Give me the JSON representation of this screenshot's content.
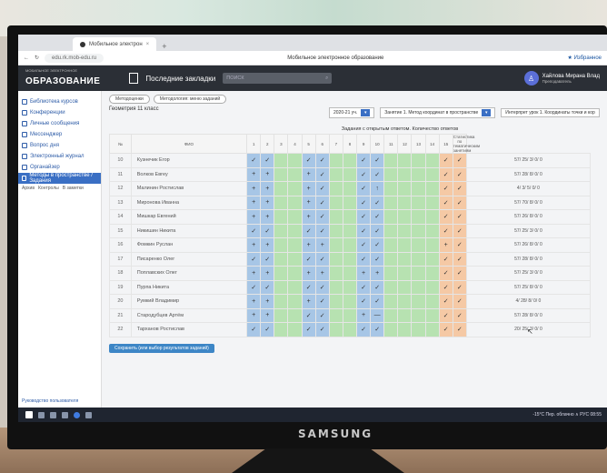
{
  "browser": {
    "tab_title": "Мобильное электрон",
    "url": "edu.rk.mob-edu.ru",
    "page_title": "Мобильное электронное образование",
    "right_link": "★ Избранное"
  },
  "app": {
    "logo_small": "МОБИЛЬНОЕ ЭЛЕКТРОННОЕ",
    "logo_big": "ОБРАЗОВАНИЕ",
    "bookmarks_label": "Последние закладки",
    "search_placeholder": "ПОИСК",
    "user_name": "Хайлова Мирана Влад",
    "user_role": "Преподаватель"
  },
  "sidebar": {
    "items": [
      {
        "label": "Библиотека курсов"
      },
      {
        "label": "Конференции"
      },
      {
        "label": "Личные сообщения"
      },
      {
        "label": "Мессенджер"
      },
      {
        "label": "Вопрос дня"
      },
      {
        "label": "Электронный журнал"
      },
      {
        "label": "Органайзер"
      },
      {
        "label": "Методы в пространстве / Задания"
      }
    ],
    "subnav": [
      "Архив",
      "Контролы",
      "В заметки"
    ],
    "footer": "Руководство пользователя"
  },
  "main": {
    "crumbs": [
      "Методоценки",
      "Методология: меню заданий"
    ],
    "subtitle": "Геометрия 11 класс",
    "selectors": [
      "2020-21 уч.",
      "Занятие 1. Метод координат в пространстве",
      "Интерпрет урок 1. Координаты точки и кор"
    ],
    "grid_title": "Задания с открытым ответом. Количество ответов",
    "col_headers": [
      "№",
      "ФИО",
      "1",
      "2",
      "3",
      "4",
      "5",
      "6",
      "7",
      "8",
      "9",
      "10",
      "11",
      "12",
      "13",
      "14",
      "15",
      "Статистика по тематическим занятиям"
    ],
    "save_label": "Сохранить (или выбор результатов заданий)"
  },
  "students": [
    {
      "num": "10",
      "name": "Кузнечик Егор",
      "stat": "57/ 25/ 3/ 0/ 0",
      "marks": [
        "✓",
        "✓",
        "",
        "",
        "✓",
        "✓",
        "",
        "",
        "✓",
        "✓",
        "",
        "",
        "",
        "",
        "✓",
        "✓"
      ]
    },
    {
      "num": "11",
      "name": "Волков Евгеу",
      "stat": "57/ 28/ 8/ 0/ 0",
      "marks": [
        "+",
        "+",
        "",
        "",
        "+",
        "✓",
        "",
        "",
        "✓",
        "✓",
        "",
        "",
        "",
        "",
        "✓",
        "✓"
      ]
    },
    {
      "num": "12",
      "name": "Малинин Ростислав",
      "stat": "4/ 3/ 5/ 0/ 0",
      "marks": [
        "+",
        "+",
        "",
        "",
        "+",
        "✓",
        "",
        "",
        "✓",
        "↑",
        "",
        "",
        "",
        "",
        "✓",
        "✓"
      ]
    },
    {
      "num": "13",
      "name": "Миронова Иванна",
      "stat": "57/ 70/ 8/ 0/ 0",
      "marks": [
        "+",
        "+",
        "",
        "",
        "+",
        "✓",
        "",
        "",
        "✓",
        "✓",
        "",
        "",
        "",
        "",
        "✓",
        "✓"
      ]
    },
    {
      "num": "14",
      "name": "Мишкар Евгений",
      "stat": "57/ 26/ 8/ 0/ 0",
      "marks": [
        "+",
        "+",
        "",
        "",
        "+",
        "✓",
        "",
        "",
        "✓",
        "✓",
        "",
        "",
        "",
        "",
        "✓",
        "✓"
      ]
    },
    {
      "num": "15",
      "name": "Никишин Никита",
      "stat": "57/ 25/ 3/ 0/ 0",
      "marks": [
        "✓",
        "✓",
        "",
        "",
        "✓",
        "✓",
        "",
        "",
        "✓",
        "✓",
        "",
        "",
        "",
        "",
        "✓",
        "✓"
      ]
    },
    {
      "num": "16",
      "name": "Фомкин Руслан",
      "stat": "57/ 26/ 8/ 0/ 0",
      "marks": [
        "+",
        "+",
        "",
        "",
        "+",
        "+",
        "",
        "",
        "✓",
        "✓",
        "",
        "",
        "",
        "",
        "+",
        "✓"
      ]
    },
    {
      "num": "17",
      "name": "Писаренко Олег",
      "stat": "57/ 28/ 8/ 0/ 0",
      "marks": [
        "✓",
        "✓",
        "",
        "",
        "✓",
        "✓",
        "",
        "",
        "✓",
        "✓",
        "",
        "",
        "",
        "",
        "✓",
        "✓"
      ]
    },
    {
      "num": "18",
      "name": "Поплавских Олег",
      "stat": "57/ 25/ 3/ 0/ 0",
      "marks": [
        "+",
        "+",
        "",
        "",
        "+",
        "+",
        "",
        "",
        "+",
        "+",
        "",
        "",
        "",
        "",
        "✓",
        "✓"
      ]
    },
    {
      "num": "19",
      "name": "Пурпа Никита",
      "stat": "57/ 25/ 8/ 0/ 0",
      "marks": [
        "✓",
        "✓",
        "",
        "",
        "✓",
        "✓",
        "",
        "",
        "✓",
        "✓",
        "",
        "",
        "",
        "",
        "✓",
        "✓"
      ]
    },
    {
      "num": "20",
      "name": "Румкий Владимир",
      "stat": "4/ 28/ 8/ 0/ 0",
      "marks": [
        "+",
        "+",
        "",
        "",
        "+",
        "✓",
        "",
        "",
        "✓",
        "✓",
        "",
        "",
        "",
        "",
        "✓",
        "✓"
      ]
    },
    {
      "num": "21",
      "name": "Стародубцев Артём",
      "stat": "57/ 28/ 8/ 0/ 0",
      "marks": [
        "+",
        "+",
        "",
        "",
        "✓",
        "✓",
        "",
        "",
        "+",
        "—",
        "",
        "",
        "",
        "",
        "✓",
        "✓"
      ]
    },
    {
      "num": "22",
      "name": "Тарханов Ростислав",
      "stat": "20/ 25/ 3/ 0/ 0",
      "marks": [
        "✓",
        "✓",
        "",
        "",
        "✓",
        "✓",
        "",
        "",
        "✓",
        "✓",
        "",
        "",
        "",
        "",
        "✓",
        "✓"
      ]
    }
  ],
  "col_colors": [
    "b",
    "b",
    "g",
    "g",
    "b",
    "b",
    "g",
    "g",
    "b",
    "b",
    "g",
    "g",
    "g",
    "g",
    "o",
    "o"
  ],
  "taskbar": {
    "tray_text": "-15°C Пер. облачно  ∧  РУС  08:55"
  },
  "monitor": {
    "brand": "SAMSUNG"
  }
}
